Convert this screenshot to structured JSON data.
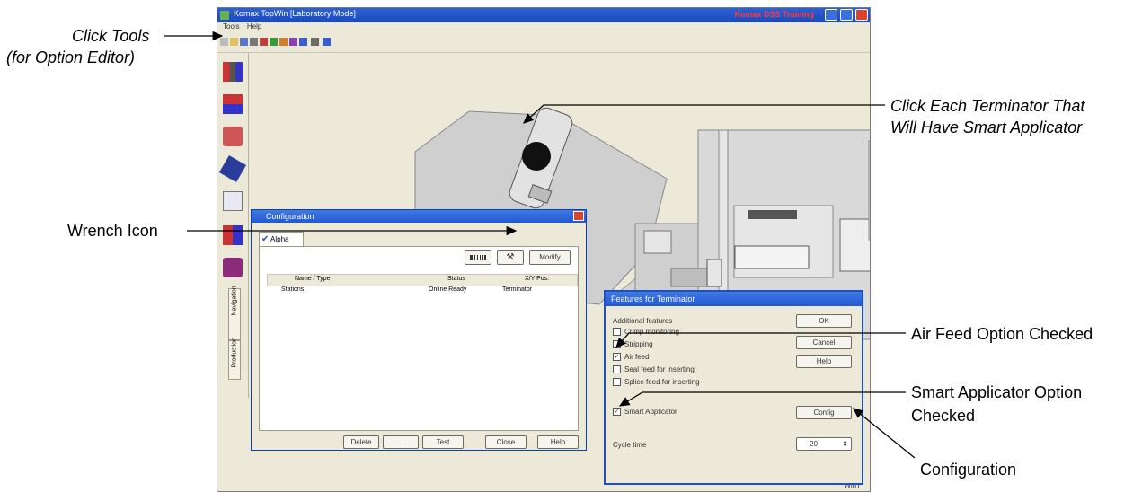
{
  "annotations": {
    "click_tools": "Click Tools",
    "option_editor": "(for Option Editor)",
    "click_terminator_line1": "Click Each Terminator That",
    "click_terminator_line2": "Will Have Smart Applicator",
    "wrench_icon": "Wrench Icon",
    "air_feed": "Air Feed Option Checked",
    "smart_applicator_line1": "Smart Applicator Option",
    "smart_applicator_line2": "Checked",
    "configuration": "Configuration"
  },
  "app": {
    "title": "Komax TopWin [Laboratory Mode]",
    "brand": "Komax DSS Training",
    "menu": [
      "Tools",
      "Help"
    ],
    "status": "WinT"
  },
  "config_dialog": {
    "title": "Configuration",
    "tab": "Alpha",
    "header_button": "Modify",
    "columns": [
      "Name / Type",
      "Status",
      "X/Y Pos."
    ],
    "row": [
      "Stations",
      "Online Ready",
      "Terminator"
    ],
    "footer_buttons": [
      "Delete",
      "...",
      "Test",
      "Close",
      "Help"
    ]
  },
  "feature_dialog": {
    "title": "Features for Terminator",
    "section_label": "Additional features",
    "options": [
      {
        "label": "Crimp monitoring",
        "checked": false
      },
      {
        "label": "Stripping",
        "checked": false
      },
      {
        "label": "Air feed",
        "checked": true
      },
      {
        "label": "Seal feed for inserting",
        "checked": false
      },
      {
        "label": "Splice feed for inserting",
        "checked": false
      },
      {
        "label": "Smart Applicator",
        "checked": true
      }
    ],
    "buttons": [
      "OK",
      "Cancel",
      "Help"
    ],
    "config_button": "Config",
    "speed_label": "Cycle time",
    "speed_value": "20"
  },
  "colors": {
    "titlebar": "#1c48b8",
    "close": "#d9442b",
    "canvas_gray": "#cfcfcf",
    "brand_red": "#ff3b3b"
  }
}
